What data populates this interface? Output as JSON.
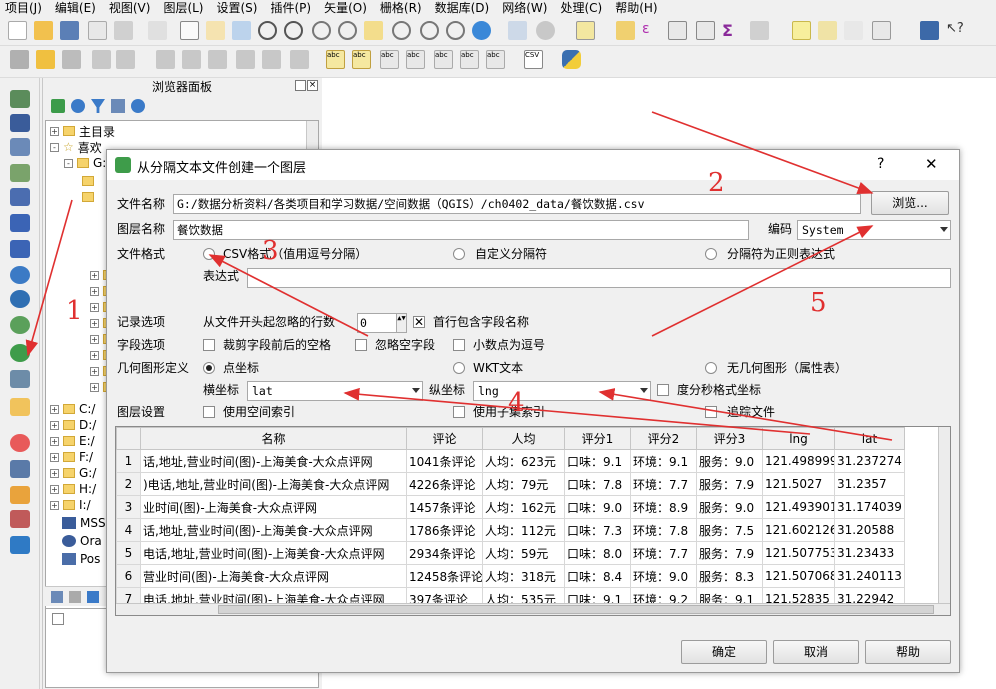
{
  "menubar": [
    "项目(J)",
    "编辑(E)",
    "视图(V)",
    "图层(L)",
    "设置(S)",
    "插件(P)",
    "矢量(O)",
    "栅格(R)",
    "数据库(D)",
    "网络(W)",
    "处理(C)",
    "帮助(H)"
  ],
  "browser": {
    "title": "浏览器面板",
    "tree": [
      "主目录",
      "喜欢",
      "G:",
      "C:/",
      "D:/",
      "E:/",
      "F:/",
      "G:/",
      "H:/",
      "I:/",
      "MSS",
      "Ora",
      "Pos"
    ]
  },
  "dialog": {
    "title": "从分隔文本文件创建一个图层",
    "help": "?",
    "close": "✕",
    "file_label": "文件名称",
    "file_value": "G:/数据分析资料/各类项目和学习数据/空间数据（QGIS）/ch0402_data/餐饮数据.csv",
    "browse": "浏览...",
    "layer_label": "图层名称",
    "layer_value": "餐饮数据",
    "encoding_label": "编码",
    "encoding_value": "System",
    "format_label": "文件格式",
    "fmt_csv": "CSV格式（值用逗号分隔）",
    "fmt_custom": "自定义分隔符",
    "fmt_regex": "分隔符为正则表达式",
    "expr_label": "表达式",
    "record_label": "记录选项",
    "skip_label": "从文件开头起忽略的行数",
    "skip_value": "0",
    "header_label": "首行包含字段名称",
    "field_label": "字段选项",
    "trim": "裁剪字段前后的空格",
    "skip_empty": "忽略空字段",
    "decimal_comma": "小数点为逗号",
    "geom_label": "几何图形定义",
    "geom_point": "点坐标",
    "geom_wkt": "WKT文本",
    "geom_none": "无几何图形（属性表）",
    "x_label": "横坐标",
    "x_value": "lat",
    "y_label": "纵坐标",
    "y_value": "lng",
    "dms": "度分秒格式坐标",
    "layer_settings": "图层设置",
    "spatial_index": "使用空间索引",
    "subset_index": "使用子集索引",
    "watch": "追踪文件",
    "ok": "确定",
    "cancel": "取消",
    "helpbtn": "帮助"
  },
  "table": {
    "columns": [
      "",
      "名称",
      "评论",
      "人均",
      "评分1",
      "评分2",
      "评分3",
      "lng",
      "lat"
    ],
    "rows": [
      [
        "1",
        "话,地址,营业时间(图)-上海美食-大众点评网",
        "1041条评论",
        "人均：623元",
        "口味：9.1",
        "环境：9.1",
        "服务：9.0",
        "121.498999",
        "31.237274"
      ],
      [
        "2",
        ")电话,地址,营业时间(图)-上海美食-大众点评网",
        "4226条评论",
        "人均：79元",
        "口味：7.8",
        "环境：7.7",
        "服务：7.9",
        "121.5027",
        "31.2357"
      ],
      [
        "3",
        "业时间(图)-上海美食-大众点评网",
        "1457条评论",
        "人均：162元",
        "口味：9.0",
        "环境：8.9",
        "服务：9.0",
        "121.493901",
        "31.174039"
      ],
      [
        "4",
        "话,地址,营业时间(图)-上海美食-大众点评网",
        "1786条评论",
        "人均：112元",
        "口味：7.3",
        "环境：7.8",
        "服务：7.5",
        "121.602126",
        "31.20588"
      ],
      [
        "5",
        "电话,地址,营业时间(图)-上海美食-大众点评网",
        "2934条评论",
        "人均：59元",
        "口味：8.0",
        "环境：7.7",
        "服务：7.9",
        "121.507753",
        "31.23433"
      ],
      [
        "6",
        "营业时间(图)-上海美食-大众点评网",
        "12458条评论",
        "人均：318元",
        "口味：8.4",
        "环境：9.0",
        "服务：8.3",
        "121.507068",
        "31.240113"
      ],
      [
        "7",
        "电话,地址,营业时间(图)-上海美食-大众点评网",
        "397条评论",
        "人均：535元",
        "口味：9.1",
        "环境：9.2",
        "服务：9.1",
        "121.52835",
        "31.22942"
      ]
    ]
  },
  "annotations": [
    "1",
    "2",
    "3",
    "4",
    "5"
  ],
  "colors": {
    "arrow": "#e03030",
    "canvas": "#ffffff",
    "panel": "#f0f0f0"
  }
}
